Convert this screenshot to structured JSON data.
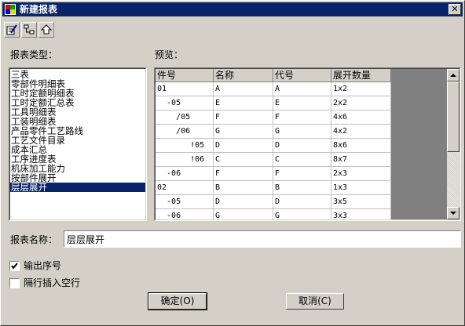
{
  "window": {
    "title": "新建报表",
    "close_glyph": "✕"
  },
  "toolbar": {
    "icons": [
      "edit-report-icon",
      "tree-structure-icon",
      "move-up-icon"
    ]
  },
  "report_type": {
    "label": "报表类型：",
    "items": [
      "三表",
      "零部件明细表",
      "工时定额明细表",
      "工时定额汇总表",
      "工具明细表",
      "工装明细表",
      "产品零件工艺路线",
      "工艺文件目录",
      "成本汇总",
      "工序进度表",
      "机床加工能力",
      "按部件展开",
      "层层展开"
    ],
    "selected_index": 12
  },
  "preview": {
    "label": "预览：",
    "columns": [
      "件号",
      "名称",
      "代号",
      "展开数量"
    ],
    "rows": [
      [
        "01",
        "A",
        "A",
        "1x2"
      ],
      [
        "  -05",
        "E",
        "E",
        "2x2"
      ],
      [
        "    /05",
        "F",
        "F",
        "4x6"
      ],
      [
        "    /06",
        "G",
        "G",
        "4x2"
      ],
      [
        "       !05",
        "D",
        "D",
        "8x6"
      ],
      [
        "       !06",
        "C",
        "C",
        "8x7"
      ],
      [
        "  -06",
        "F",
        "F",
        "2x3"
      ],
      [
        "02",
        "B",
        "B",
        "1x3"
      ],
      [
        "  -05",
        "D",
        "D",
        "3x5"
      ],
      [
        "  -06",
        "G",
        "G",
        "3x3"
      ]
    ]
  },
  "report_name": {
    "label": "报表名称：",
    "value": "层层展开"
  },
  "options": [
    {
      "label": "输出序号",
      "checked": true
    },
    {
      "label": "隔行插入空行",
      "checked": false
    }
  ],
  "buttons": {
    "ok": "确定(O)",
    "cancel": "取消(C)"
  },
  "colors": {
    "titlebar": "#0a246a",
    "face": "#d4d0c8",
    "selection": "#0a246a"
  }
}
